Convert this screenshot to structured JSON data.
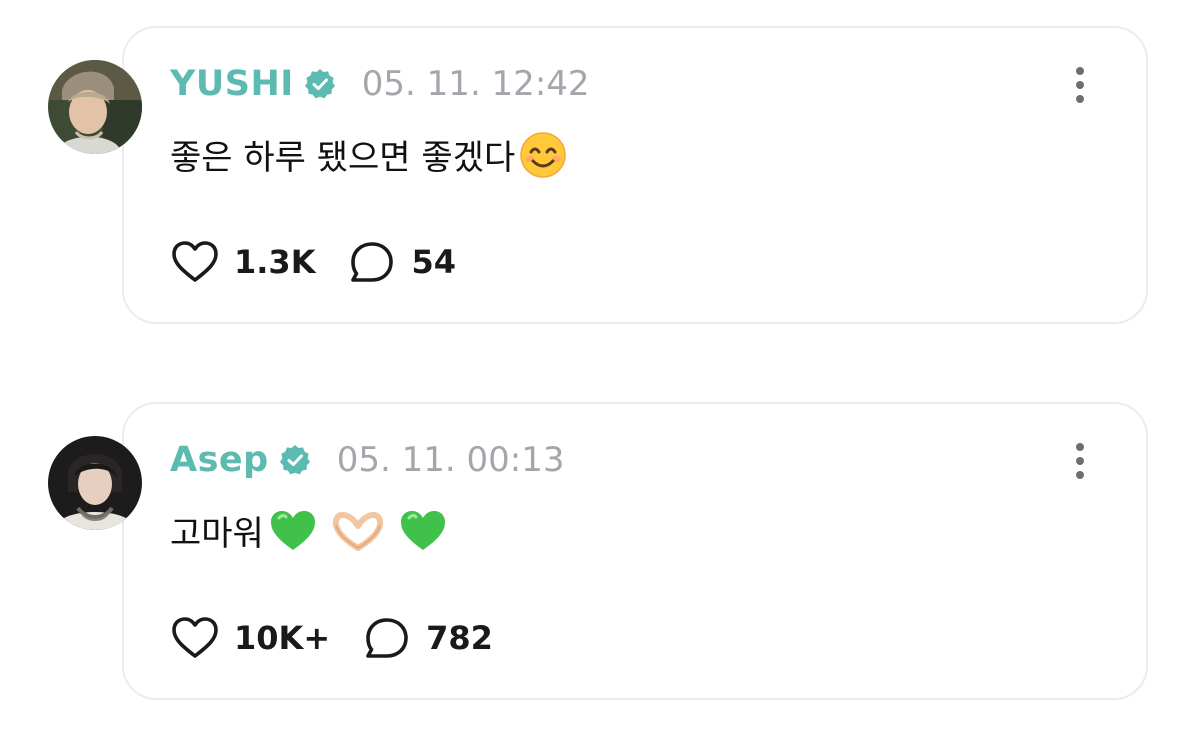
{
  "posts": [
    {
      "author": "YUSHI",
      "timestamp": "05. 11. 12:42",
      "text": "좋은 하루 됐으면 좋겠다",
      "emojis": [
        "smiling-face-emoji"
      ],
      "likes": "1.3K",
      "comments": "54",
      "name_color": "#5cbab0"
    },
    {
      "author": "Asep",
      "timestamp": "05. 11. 00:13",
      "text": "고마워",
      "emojis": [
        "green-heart-emoji",
        "heart-hands-emoji",
        "green-heart-emoji"
      ],
      "likes": "10K+",
      "comments": "782",
      "name_color": "#5cbab0"
    }
  ],
  "colors": {
    "verified": "#5cbab0",
    "timestamp": "#a3a7ab",
    "card_border": "#e9ecef"
  }
}
